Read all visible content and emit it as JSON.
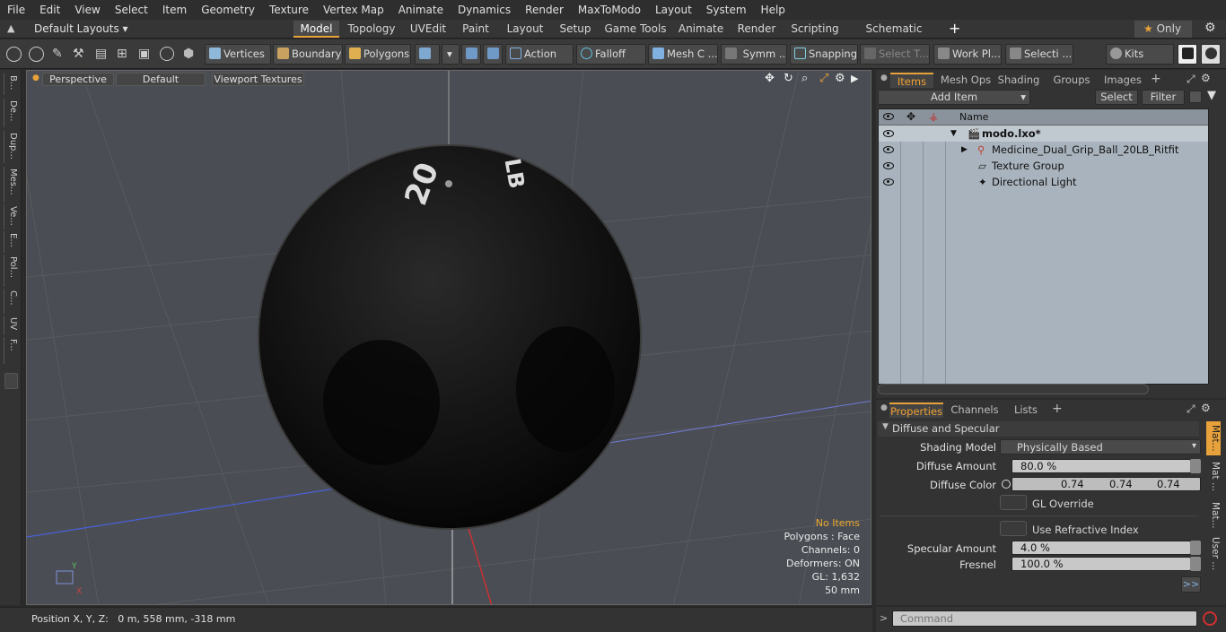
{
  "menu": [
    "File",
    "Edit",
    "View",
    "Select",
    "Item",
    "Geometry",
    "Texture",
    "Vertex Map",
    "Animate",
    "Dynamics",
    "Render",
    "MaxToModo",
    "Layout",
    "System",
    "Help"
  ],
  "layout_selector": "Default Layouts",
  "layout_tabs": [
    "Model",
    "Topology",
    "UVEdit",
    "Paint",
    "Layout",
    "Setup",
    "Game Tools",
    "Animate",
    "Render",
    "Scripting",
    "Schematic Fusion"
  ],
  "only_label": "Only",
  "toolbar": {
    "vertices": "Vertices",
    "boundary": "Boundary",
    "polygons": "Polygons",
    "action": "Action",
    "falloff": "Falloff",
    "mesh": "Mesh C ...",
    "symm": "Symm ...",
    "snapping": "Snapping",
    "select_t": "Select T...",
    "workplane": "Work Pl...",
    "selecti": "Selecti ...",
    "kits": "Kits"
  },
  "left_tabs": [
    "B...",
    "De...",
    "Dup...",
    "Mes...",
    "Ve...",
    "E...",
    "Pol...",
    "C...",
    "UV",
    "F..."
  ],
  "viewport": {
    "view": "Perspective",
    "shading": "Default",
    "textures": "Viewport Textures",
    "info": {
      "items": "No Items",
      "polygons": "Polygons : Face",
      "channels": "Channels: 0",
      "deformers": "Deformers: ON",
      "gl": "GL: 1,632",
      "scale": "50 mm"
    },
    "ball_labels": {
      "top1": "20",
      "top2": "LB"
    }
  },
  "status": "Position X, Y, Z:   0 m, 558 mm, -318 mm",
  "items_panel": {
    "tabs": [
      "Items",
      "Mesh Ops",
      "Shading",
      "Groups",
      "Images"
    ],
    "add_item": "Add Item",
    "select": "Select",
    "filter": "Filter",
    "col_name": "Name",
    "rows": [
      "modo.lxo*",
      "Medicine_Dual_Grip_Ball_20LB_Ritfit",
      "Texture Group",
      "Directional Light"
    ]
  },
  "properties": {
    "tabs": [
      "Properties",
      "Channels",
      "Lists"
    ],
    "section": "Diffuse and Specular",
    "shading_model_label": "Shading Model",
    "shading_model": "Physically Based",
    "diffuse_amount_label": "Diffuse Amount",
    "diffuse_amount": "80.0 %",
    "diffuse_color_label": "Diffuse Color",
    "diffuse_color": [
      "0.74",
      "0.74",
      "0.74"
    ],
    "gl_override": "GL Override",
    "use_refractive": "Use Refractive Index",
    "specular_amount_label": "Specular Amount",
    "specular_amount": "4.0 %",
    "fresnel_label": "Fresnel",
    "fresnel": "100.0 %",
    "side_tabs": [
      "Mat...",
      "Mat ...",
      "Mat...",
      "User ..."
    ],
    "more": ">>"
  },
  "command_placeholder": "Command",
  "colors": {
    "accent": "#e8a23b",
    "panel": "#333333",
    "list_bg": "#a9b3bd",
    "viewport": "#4a4e54"
  }
}
